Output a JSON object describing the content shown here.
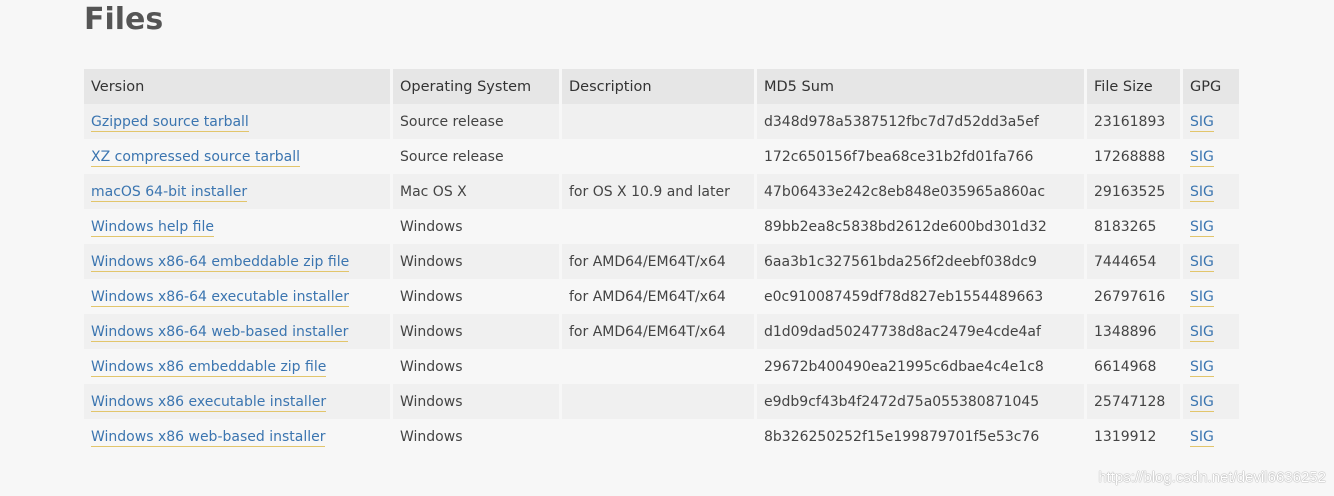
{
  "page": {
    "title": "Files"
  },
  "table": {
    "headers": {
      "version": "Version",
      "os": "Operating System",
      "description": "Description",
      "md5": "MD5 Sum",
      "size": "File Size",
      "gpg": "GPG"
    },
    "rows": [
      {
        "version": "Gzipped source tarball",
        "os": "Source release",
        "description": "",
        "md5": "d348d978a5387512fbc7d7d52dd3a5ef",
        "size": "23161893",
        "gpg": "SIG"
      },
      {
        "version": "XZ compressed source tarball",
        "os": "Source release",
        "description": "",
        "md5": "172c650156f7bea68ce31b2fd01fa766",
        "size": "17268888",
        "gpg": "SIG"
      },
      {
        "version": "macOS 64-bit installer",
        "os": "Mac OS X",
        "description": "for OS X 10.9 and later",
        "md5": "47b06433e242c8eb848e035965a860ac",
        "size": "29163525",
        "gpg": "SIG"
      },
      {
        "version": "Windows help file",
        "os": "Windows",
        "description": "",
        "md5": "89bb2ea8c5838bd2612de600bd301d32",
        "size": "8183265",
        "gpg": "SIG"
      },
      {
        "version": "Windows x86-64 embeddable zip file",
        "os": "Windows",
        "description": "for AMD64/EM64T/x64",
        "md5": "6aa3b1c327561bda256f2deebf038dc9",
        "size": "7444654",
        "gpg": "SIG"
      },
      {
        "version": "Windows x86-64 executable installer",
        "os": "Windows",
        "description": "for AMD64/EM64T/x64",
        "md5": "e0c910087459df78d827eb1554489663",
        "size": "26797616",
        "gpg": "SIG"
      },
      {
        "version": "Windows x86-64 web-based installer",
        "os": "Windows",
        "description": "for AMD64/EM64T/x64",
        "md5": "d1d09dad50247738d8ac2479e4cde4af",
        "size": "1348896",
        "gpg": "SIG"
      },
      {
        "version": "Windows x86 embeddable zip file",
        "os": "Windows",
        "description": "",
        "md5": "29672b400490ea21995c6dbae4c4e1c8",
        "size": "6614968",
        "gpg": "SIG"
      },
      {
        "version": "Windows x86 executable installer",
        "os": "Windows",
        "description": "",
        "md5": "e9db9cf43b4f2472d75a055380871045",
        "size": "25747128",
        "gpg": "SIG"
      },
      {
        "version": "Windows x86 web-based installer",
        "os": "Windows",
        "description": "",
        "md5": "8b326250252f15e199879701f5e53c76",
        "size": "1319912",
        "gpg": "SIG"
      }
    ]
  },
  "watermark": "https://blog.csdn.net/devil6636252",
  "colors": {
    "link": "#3b75b0",
    "link_underline": "#e2c56b",
    "header_bg": "#e6e6e6",
    "row_alt_bg": "#f0f0f0",
    "page_bg": "#f7f7f7"
  }
}
